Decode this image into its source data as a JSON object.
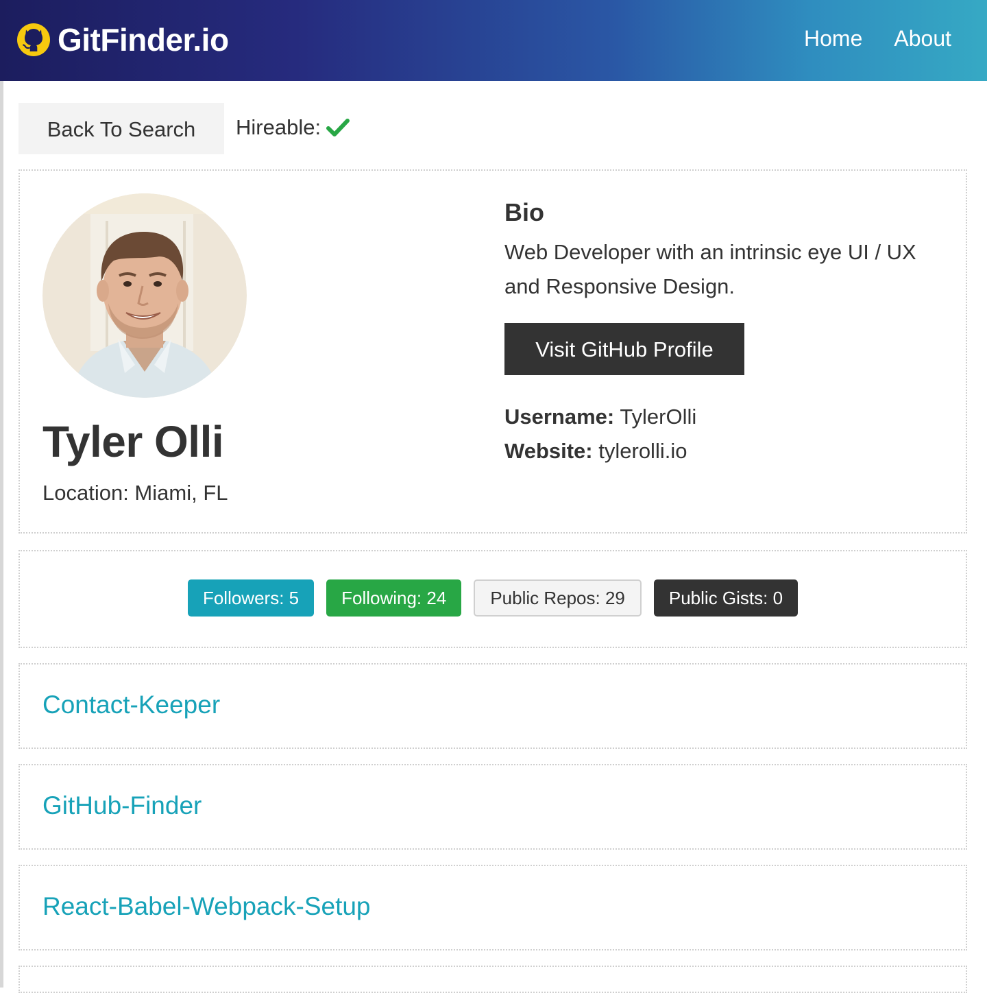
{
  "navbar": {
    "brand_icon": "github-icon",
    "brand_title": "GitFinder.io",
    "links": [
      {
        "label": "Home"
      },
      {
        "label": "About"
      }
    ]
  },
  "toolbar": {
    "back_label": "Back To Search",
    "hireable_label": "Hireable:",
    "hireable_icon": "check-icon",
    "hireable_value": true,
    "hireable_color": "#28a745"
  },
  "profile": {
    "avatar_icon": "avatar-photo",
    "name": "Tyler Olli",
    "location": "Location: Miami, FL",
    "bio_heading": "Bio",
    "bio": "Web Developer with an intrinsic eye UI / UX and Responsive Design.",
    "visit_label": "Visit GitHub Profile",
    "username_label": "Username:",
    "username": "TylerOlli",
    "website_label": "Website:",
    "website": "tylerolli.io"
  },
  "stats": [
    {
      "label": "Followers: 5",
      "variant": "primary",
      "color": "#17a2b8"
    },
    {
      "label": "Following: 24",
      "variant": "success",
      "color": "#28a745"
    },
    {
      "label": "Public Repos: 29",
      "variant": "light",
      "color": "#f4f4f4"
    },
    {
      "label": "Public Gists: 0",
      "variant": "dark",
      "color": "#333333"
    }
  ],
  "repos": [
    {
      "name": "Contact-Keeper"
    },
    {
      "name": "GitHub-Finder"
    },
    {
      "name": "React-Babel-Webpack-Setup"
    }
  ],
  "colors": {
    "accent": "#17a2b8",
    "dark": "#333333",
    "navbar_gradient": [
      "#1c1d5e",
      "#36a9c4"
    ]
  }
}
